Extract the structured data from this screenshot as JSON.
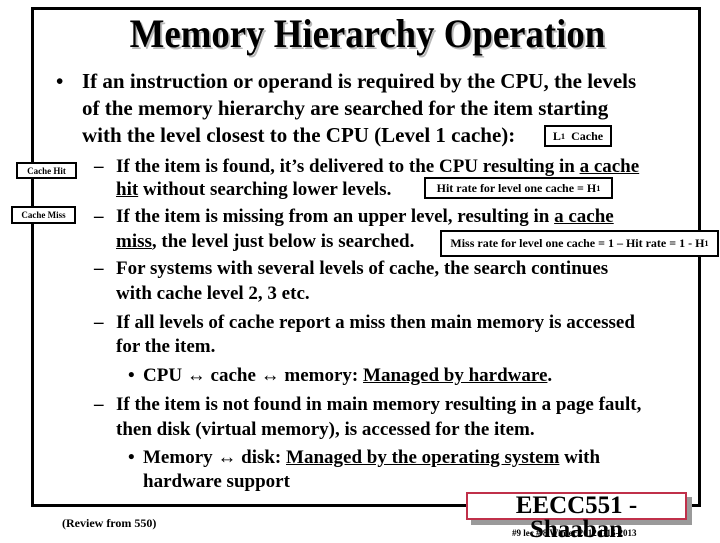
{
  "slide": {
    "title": "Memory Hierarchy Operation",
    "main_bullet": {
      "lines": [
        "If an instruction or operand is required by the CPU, the levels",
        "of the memory hierarchy are searched for the item starting",
        "with the level closest to the CPU (Level 1 cache):"
      ]
    },
    "l1_cache_box": {
      "label": "L",
      "sub": "1",
      "suffix": "Cache"
    },
    "side_labels": {
      "hit": "Cache Hit",
      "miss": "Cache Miss"
    },
    "sub_bullets": {
      "hit": {
        "line1_pre": "If the item is found, it’s delivered to the CPU resulting in ",
        "line1_u": "a cache",
        "line2_u": "hit",
        "line2_post": " without searching lower levels."
      },
      "hit_rate_box": {
        "text": "Hit rate for level one cache  =  H",
        "sub": "1"
      },
      "miss": {
        "line1_pre": "If the item is missing from an upper level, resulting in ",
        "line1_u": "a cache",
        "line2_u": "miss",
        "line2_post": ", the level just below is searched."
      },
      "miss_rate_box": {
        "text": "Miss rate for level one cache  = 1 – Hit rate =  1 - H",
        "sub": "1"
      },
      "several_levels": [
        "For systems with several levels of cache, the search continues",
        "with cache level 2, 3 etc."
      ],
      "all_miss": [
        "If all levels of cache report a miss then main memory is accessed",
        "for the item."
      ],
      "cpu_cache_memory": {
        "pre": "CPU ↔ cache ↔ memory:  ",
        "u": "Managed by hardware",
        "post": "."
      },
      "page_fault": [
        "If the item is not found in main memory resulting in a page fault,",
        "then disk (virtual memory), is accessed for the item."
      ],
      "memory_disk": {
        "pre": "Memory ↔ disk:   ",
        "u": "Managed by the operating system",
        "post": " with",
        "line2": "hardware support"
      }
    },
    "footer": {
      "badge": "EECC551 - Shaaban",
      "left": "(Review from 550)",
      "right": "#9   lec # 8   Winter 2012  1-16-2013"
    },
    "symbols": {
      "bullet": "•",
      "dash": "–"
    },
    "colors": {
      "badge_border": "#c0304a",
      "shadow": "#9a9a9a"
    }
  }
}
